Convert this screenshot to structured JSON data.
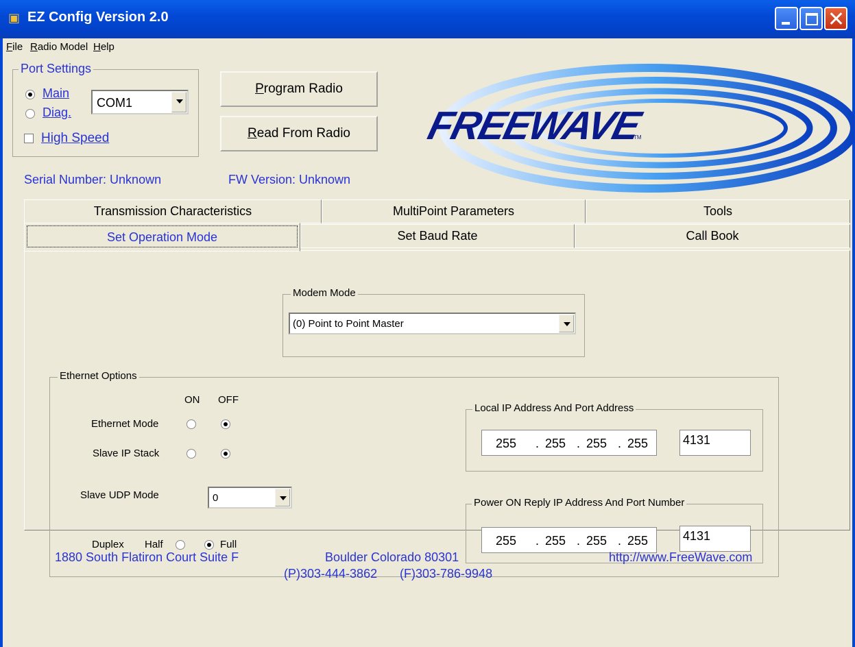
{
  "window": {
    "title": "EZ Config Version 2.0"
  },
  "menu": {
    "file": "File",
    "radio_model": "Radio Model",
    "help": "Help"
  },
  "port_settings": {
    "legend": "Port Settings",
    "main_label": "Main",
    "diag_label": "Diag.",
    "high_speed_label": "High Speed",
    "port_value": "COM1",
    "selected": "Main",
    "high_speed_checked": false
  },
  "buttons": {
    "program_radio": "Program Radio",
    "read_from_radio": "Read From Radio"
  },
  "logo": {
    "text": "FREEWAVE",
    "tm": "TM"
  },
  "status": {
    "serial_number": "Serial Number: Unknown",
    "fw_version": "FW Version: Unknown"
  },
  "tabs": {
    "row1": [
      "Transmission Characteristics",
      "MultiPoint Parameters",
      "Tools"
    ],
    "row2": [
      "Set Operation Mode",
      "Set Baud Rate",
      "Call Book"
    ],
    "active": "Set Operation Mode"
  },
  "modem_mode": {
    "legend": "Modem Mode",
    "value": "(0) Point to Point Master"
  },
  "ethernet": {
    "legend": "Ethernet Options",
    "on_label": "ON",
    "off_label": "OFF",
    "ethernet_mode_label": "Ethernet Mode",
    "slave_ip_stack_label": "Slave IP Stack",
    "slave_udp_mode_label": "Slave UDP Mode",
    "slave_udp_mode_value": "0",
    "duplex_label": "Duplex",
    "half_label": "Half",
    "full_label": "Full",
    "ethernet_mode": "OFF",
    "slave_ip_stack": "OFF",
    "duplex": "Full"
  },
  "local_ip": {
    "legend": "Local IP Address And Port Address",
    "octets": [
      "255",
      "255",
      "255",
      "255"
    ],
    "port": "4131"
  },
  "power_on_reply": {
    "legend": "Power ON Reply IP Address And Port Number",
    "octets": [
      "255",
      "255",
      "255",
      "255"
    ],
    "port": "4131"
  },
  "footer": {
    "address": "1880 South Flatiron Court Suite F",
    "city": "Boulder Colorado 80301",
    "url": "http://www.FreeWave.com",
    "phone": "(P)303-444-3862",
    "fax": "(F)303-786-9948"
  },
  "colors": {
    "title_bar": "#0349d6",
    "link_blue": "#2a33d4",
    "face": "#ece9d8"
  }
}
